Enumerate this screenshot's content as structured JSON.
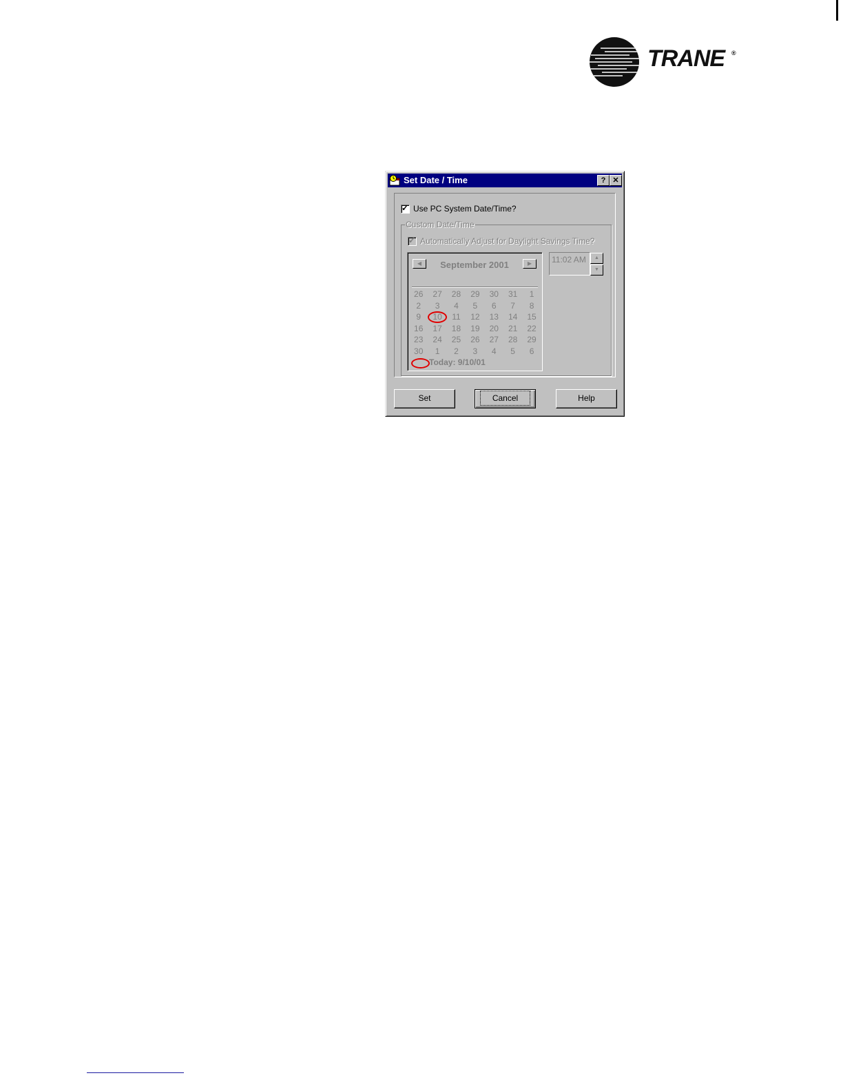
{
  "brand": {
    "logo_text": "TRANE",
    "registered": "®"
  },
  "dialog": {
    "title": "Set Date / Time",
    "help_btn": "?",
    "close_btn": "✕",
    "use_pc": {
      "label": "Use PC System Date/Time?",
      "checked": true
    },
    "group_label": "Custom Date/Time",
    "auto_dst": {
      "label": "Automatically Adjust for Daylight Savings Time?",
      "checked": true,
      "enabled": false
    },
    "calendar": {
      "month_label": "September 2001",
      "prev": "◀",
      "next": "▶",
      "weeks": [
        [
          "26",
          "27",
          "28",
          "29",
          "30",
          "31",
          "1"
        ],
        [
          "2",
          "3",
          "4",
          "5",
          "6",
          "7",
          "8"
        ],
        [
          "9",
          "10",
          "11",
          "12",
          "13",
          "14",
          "15"
        ],
        [
          "16",
          "17",
          "18",
          "19",
          "20",
          "21",
          "22"
        ],
        [
          "23",
          "24",
          "25",
          "26",
          "27",
          "28",
          "29"
        ],
        [
          "30",
          "1",
          "2",
          "3",
          "4",
          "5",
          "6"
        ]
      ],
      "today_label": "Today: 9/10/01",
      "highlighted_day": "10",
      "annotation_color": "#e00000"
    },
    "time": {
      "value": "11:02 AM",
      "up": "▲",
      "down": "▼"
    },
    "buttons": {
      "set": "Set",
      "cancel": "Cancel",
      "help": "Help"
    }
  }
}
